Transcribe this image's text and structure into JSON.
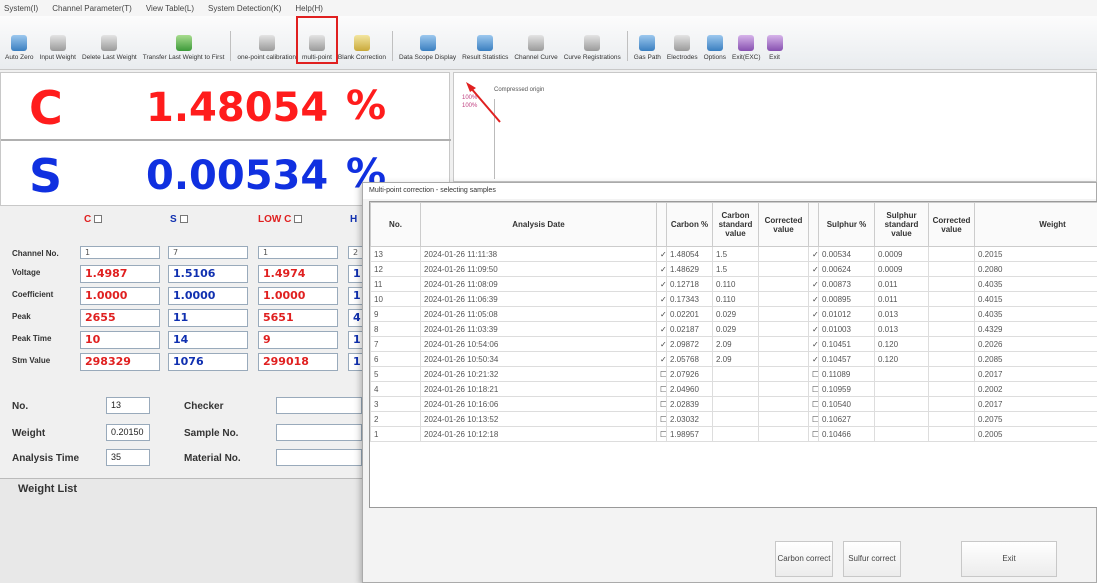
{
  "menu": [
    "System(I)",
    "Channel Parameter(T)",
    "View Table(L)",
    "System Detection(K)",
    "Help(H)"
  ],
  "toolbar": [
    {
      "label": "Auto Zero",
      "icon": "flask-icon",
      "color": "b"
    },
    {
      "label": "Input Weight",
      "icon": "scale-icon",
      "color": "gr"
    },
    {
      "label": "Delete Last Weight",
      "icon": "delete-icon",
      "color": "gr"
    },
    {
      "label": "Transfer Last Weight to First",
      "icon": "transfer-icon",
      "color": "g"
    },
    {
      "label": "one-point calibration",
      "icon": "calibration-icon",
      "color": "gr"
    },
    {
      "label": "multi-point",
      "icon": "multipoint-icon",
      "color": "gr",
      "selected": true
    },
    {
      "label": "Blank Correction",
      "icon": "blank-icon",
      "color": "y"
    },
    {
      "label": "Data Scope Display",
      "icon": "scope-icon",
      "color": "b"
    },
    {
      "label": "Result Statistics",
      "icon": "statistics-icon",
      "color": "b"
    },
    {
      "label": "Channel Curve",
      "icon": "channel-curve-icon",
      "color": "gr"
    },
    {
      "label": "Curve Registrations",
      "icon": "curve-reg-icon",
      "color": "gr"
    },
    {
      "label": "Gas Path",
      "icon": "gas-path-icon",
      "color": "b"
    },
    {
      "label": "Electrodes",
      "icon": "electrode-icon",
      "color": "gr"
    },
    {
      "label": "Options",
      "icon": "options-icon",
      "color": "b"
    },
    {
      "label": "Exit(EXC)",
      "icon": "exit-icon",
      "color": "p"
    },
    {
      "label": "Exit",
      "icon": "exit2-icon",
      "color": "p"
    }
  ],
  "result": {
    "c_label": "C",
    "c_value": "1.48054",
    "c_unit": "%",
    "s_label": "S",
    "s_value": "0.00534",
    "s_unit": "%"
  },
  "channels": {
    "headers": [
      "C",
      "S",
      "LOW C",
      "H"
    ],
    "row_labels": [
      "Channel No.",
      "Voltage",
      "Coefficient",
      "Peak",
      "Peak Time",
      "Stm Value"
    ],
    "columns": [
      {
        "channel": "1",
        "voltage": "1.4987",
        "coefficient": "1.0000",
        "peak": "2655",
        "peak_time": "10",
        "stm": "298329",
        "color": "#e02020"
      },
      {
        "channel": "7",
        "voltage": "1.5106",
        "coefficient": "1.0000",
        "peak": "11",
        "peak_time": "14",
        "stm": "1076",
        "color": "#1030b0"
      },
      {
        "channel": "1",
        "voltage": "1.4974",
        "coefficient": "1.0000",
        "peak": "5651",
        "peak_time": "9",
        "stm": "299018",
        "color": "#e02020"
      },
      {
        "channel": "2",
        "voltage": "1",
        "coefficient": "1",
        "peak": "4",
        "peak_time": "1",
        "stm": "1",
        "color": "#1030b0"
      }
    ]
  },
  "info": {
    "no_label": "No.",
    "no_value": "13",
    "checker_label": "Checker",
    "checker_value": "",
    "weight_label": "Weight",
    "weight_value": "0.20150",
    "sample_label": "Sample No.",
    "sample_value": "",
    "time_label": "Analysis Time",
    "time_value": "35",
    "material_label": "Material No.",
    "material_value": ""
  },
  "weight_list": {
    "title": "Weight List"
  },
  "graph": {
    "y1": "100%",
    "y2": "100%",
    "legend": "Compressed origin"
  },
  "dialog": {
    "title": "Multi-point correction - selecting samples",
    "headers": [
      "No.",
      "Analysis Date",
      "",
      "Carbon %",
      "Carbon standard value",
      "Corrected value",
      "",
      "Sulphur %",
      "Sulphur standard value",
      "Corrected value",
      "Weight"
    ],
    "rows": [
      {
        "no": "13",
        "date": "2024-01-26 11:11:38",
        "c_chk": true,
        "carbon": "1.48054",
        "c_std": "1.5",
        "s_chk": true,
        "sulphur": "0.00534",
        "s_std": "0.0009",
        "weight": "0.2015"
      },
      {
        "no": "12",
        "date": "2024-01-26 11:09:50",
        "c_chk": true,
        "carbon": "1.48629",
        "c_std": "1.5",
        "s_chk": true,
        "sulphur": "0.00624",
        "s_std": "0.0009",
        "weight": "0.2080"
      },
      {
        "no": "11",
        "date": "2024-01-26 11:08:09",
        "c_chk": true,
        "carbon": "0.12718",
        "c_std": "0.110",
        "s_chk": true,
        "sulphur": "0.00873",
        "s_std": "0.011",
        "weight": "0.4035"
      },
      {
        "no": "10",
        "date": "2024-01-26 11:06:39",
        "c_chk": true,
        "carbon": "0.17343",
        "c_std": "0.110",
        "s_chk": true,
        "sulphur": "0.00895",
        "s_std": "0.011",
        "weight": "0.4015"
      },
      {
        "no": "9",
        "date": "2024-01-26 11:05:08",
        "c_chk": true,
        "carbon": "0.02201",
        "c_std": "0.029",
        "s_chk": true,
        "sulphur": "0.01012",
        "s_std": "0.013",
        "weight": "0.4035"
      },
      {
        "no": "8",
        "date": "2024-01-26 11:03:39",
        "c_chk": true,
        "carbon": "0.02187",
        "c_std": "0.029",
        "s_chk": true,
        "sulphur": "0.01003",
        "s_std": "0.013",
        "weight": "0.4329"
      },
      {
        "no": "7",
        "date": "2024-01-26 10:54:06",
        "c_chk": true,
        "carbon": "2.09872",
        "c_std": "2.09",
        "s_chk": true,
        "sulphur": "0.10451",
        "s_std": "0.120",
        "weight": "0.2026"
      },
      {
        "no": "6",
        "date": "2024-01-26 10:50:34",
        "c_chk": true,
        "carbon": "2.05768",
        "c_std": "2.09",
        "s_chk": true,
        "sulphur": "0.10457",
        "s_std": "0.120",
        "weight": "0.2085"
      },
      {
        "no": "5",
        "date": "2024-01-26 10:21:32",
        "c_chk": false,
        "carbon": "2.07926",
        "c_std": "",
        "s_chk": false,
        "sulphur": "0.11089",
        "s_std": "",
        "weight": "0.2017"
      },
      {
        "no": "4",
        "date": "2024-01-26 10:18:21",
        "c_chk": false,
        "carbon": "2.04960",
        "c_std": "",
        "s_chk": false,
        "sulphur": "0.10959",
        "s_std": "",
        "weight": "0.2002"
      },
      {
        "no": "3",
        "date": "2024-01-26 10:16:06",
        "c_chk": false,
        "carbon": "2.02839",
        "c_std": "",
        "s_chk": false,
        "sulphur": "0.10540",
        "s_std": "",
        "weight": "0.2017"
      },
      {
        "no": "2",
        "date": "2024-01-26 10:13:52",
        "c_chk": false,
        "carbon": "2.03032",
        "c_std": "",
        "s_chk": false,
        "sulphur": "0.10627",
        "s_std": "",
        "weight": "0.2075"
      },
      {
        "no": "1",
        "date": "2024-01-26 10:12:18",
        "c_chk": false,
        "carbon": "1.98957",
        "c_std": "",
        "s_chk": false,
        "sulphur": "0.10466",
        "s_std": "",
        "weight": "0.2005"
      }
    ],
    "btn_carbon": "Carbon correct",
    "btn_sulfur": "Sulfur correct",
    "btn_exit": "Exit"
  }
}
